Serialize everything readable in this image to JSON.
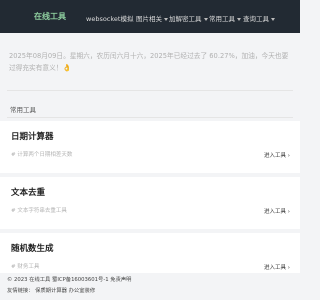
{
  "nav": {
    "logo": "在线工具",
    "items": [
      {
        "label": "websocket模拟",
        "dropdown": false
      },
      {
        "label": "图片相关",
        "dropdown": true
      },
      {
        "label": "加解密工具",
        "dropdown": true
      },
      {
        "label": "常用工具",
        "dropdown": true
      },
      {
        "label": "查询工具",
        "dropdown": true
      }
    ]
  },
  "notice": {
    "text": "2025年08月09日。星期六，农历闰六月十六，2025年已经过去了 60.27%，加油，今天也要过得充实有意义！",
    "emoji": "👌"
  },
  "section": {
    "label": "常用工具"
  },
  "tools": [
    {
      "title": "日期计算器",
      "desc": "# 计算两个日期相差天数",
      "enter": "进入工具 ›"
    },
    {
      "title": "文本去重",
      "desc": "# 文本字符串去重工具",
      "enter": "进入工具 ›"
    },
    {
      "title": "随机数生成",
      "desc": "# 财务工具",
      "enter": "进入工具 ›"
    }
  ],
  "footer": {
    "line1": "© 2023 在线工具 蜀ICP备16003601号-1 免责声明",
    "line2": "友情链接：  保质期计算器 办公室装修"
  },
  "colors": {
    "nav_bg": "#222a33",
    "logo": "#8fd0a0",
    "card_bg": "#ffffff",
    "page_bg": "#f3f4f6"
  }
}
